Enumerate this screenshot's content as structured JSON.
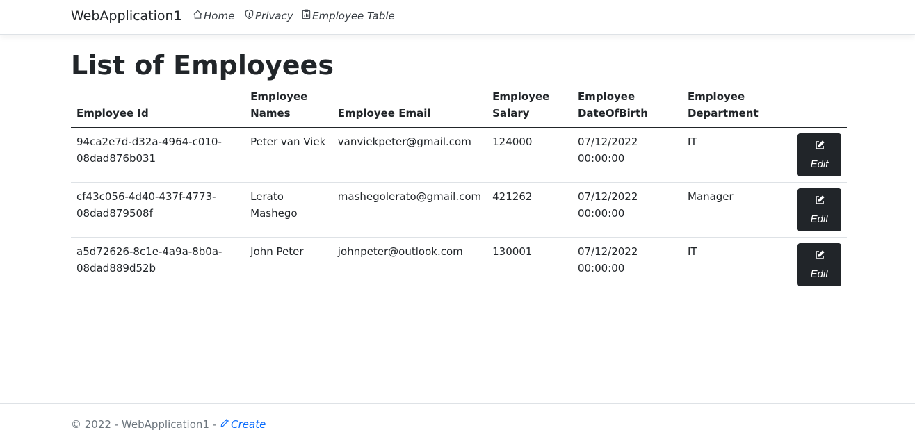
{
  "nav": {
    "brand": "WebApplication1",
    "items": [
      {
        "label": "Home",
        "icon": "house-icon"
      },
      {
        "label": "Privacy",
        "icon": "shield-icon"
      },
      {
        "label": "Employee Table",
        "icon": "clipboard-chart-icon"
      }
    ]
  },
  "page": {
    "title": "List of Employees"
  },
  "table": {
    "headers": [
      "Employee Id",
      "Employee Names",
      "Employee Email",
      "Employee Salary",
      "Employee DateOfBirth",
      "Employee Department"
    ],
    "edit_label": "Edit",
    "rows": [
      {
        "id": "94ca2e7d-d32a-4964-c010-08dad876b031",
        "name": "Peter van Viek",
        "email": "vanviekpeter@gmail.com",
        "salary": "124000",
        "dob": "07/12/2022 00:00:00",
        "department": "IT"
      },
      {
        "id": "cf43c056-4d40-437f-4773-08dad879508f",
        "name": "Lerato Mashego",
        "email": "mashegolerato@gmail.com",
        "salary": "421262",
        "dob": "07/12/2022 00:00:00",
        "department": "Manager"
      },
      {
        "id": "a5d72626-8c1e-4a9a-8b0a-08dad889d52b",
        "name": "John Peter",
        "email": "johnpeter@outlook.com",
        "salary": "130001",
        "dob": "07/12/2022 00:00:00",
        "department": "IT"
      }
    ]
  },
  "footer": {
    "copyright": "© 2022 - WebApplication1 -",
    "create_label": "Create"
  },
  "colors": {
    "dark": "#212529",
    "link": "#0d6efd",
    "muted": "#6c757d",
    "border": "#dee2e6"
  }
}
